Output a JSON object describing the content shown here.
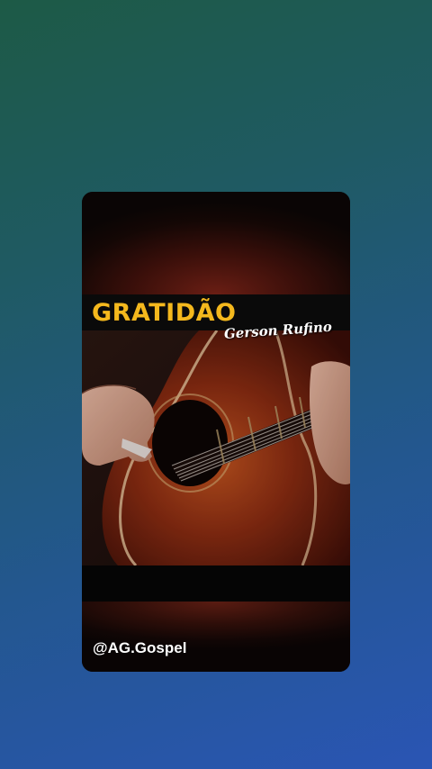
{
  "video": {
    "title": "GRATIDÃO",
    "artist": "Gerson Rufino",
    "channel_handle": "@AG.Gospel"
  },
  "colors": {
    "title": "#f4b81d",
    "background_top": "#1d5a46",
    "background_bottom": "#2a55b4"
  }
}
